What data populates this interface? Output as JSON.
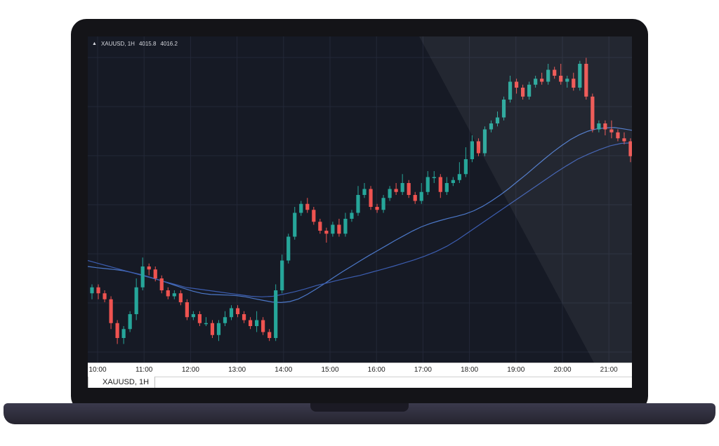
{
  "header": {
    "symbol_label": "XAUUSD, 1H",
    "value1": "4015.8",
    "value2": "4016.2"
  },
  "tab": {
    "label": "XAUUSD, 1H"
  },
  "colors": {
    "up": "#26a69a",
    "down": "#ef5350",
    "ma_fast": "#4c78c9",
    "ma_slow": "#3c5db0",
    "grid": "#232838"
  },
  "chart_data": {
    "type": "candlestick",
    "x_ticks": [
      "10:00",
      "11:00",
      "12:00",
      "13:00",
      "14:00",
      "15:00",
      "16:00",
      "17:00",
      "18:00",
      "19:00",
      "20:00",
      "21:00"
    ],
    "ylim": [
      0,
      100
    ],
    "grid": true,
    "series": [
      {
        "type": "candles",
        "values": [
          [
            19,
            21,
            17,
            22
          ],
          [
            21,
            19,
            17,
            22
          ],
          [
            19,
            17,
            16,
            20
          ],
          [
            17,
            9,
            7,
            18
          ],
          [
            9,
            4,
            2,
            10
          ],
          [
            4,
            7,
            2,
            8
          ],
          [
            7,
            12,
            6,
            13
          ],
          [
            12,
            21,
            10,
            24
          ],
          [
            21,
            28,
            20,
            31
          ],
          [
            28,
            27,
            25,
            29
          ],
          [
            27,
            24,
            23,
            28
          ],
          [
            24,
            20,
            19,
            25
          ],
          [
            20,
            18,
            17,
            21
          ],
          [
            18,
            19,
            17,
            20
          ],
          [
            19,
            16,
            15,
            20
          ],
          [
            16,
            11,
            10,
            17
          ],
          [
            11,
            12,
            10,
            13
          ],
          [
            12,
            9,
            8,
            13
          ],
          [
            9,
            9,
            8,
            11
          ],
          [
            9,
            5,
            4,
            10
          ],
          [
            5,
            9,
            3,
            10
          ],
          [
            9,
            11,
            8,
            13
          ],
          [
            11,
            14,
            10,
            15
          ],
          [
            14,
            12,
            11,
            15
          ],
          [
            12,
            10,
            9,
            13
          ],
          [
            10,
            8,
            7,
            11
          ],
          [
            8,
            10,
            6,
            13
          ],
          [
            10,
            6,
            5,
            11
          ],
          [
            6,
            4,
            3,
            7
          ],
          [
            4,
            20,
            3,
            22
          ],
          [
            20,
            30,
            19,
            32
          ],
          [
            30,
            38,
            29,
            39
          ],
          [
            38,
            46,
            37,
            48
          ],
          [
            46,
            49,
            45,
            50
          ],
          [
            49,
            47,
            46,
            51
          ],
          [
            47,
            43,
            42,
            48
          ],
          [
            43,
            40,
            39,
            44
          ],
          [
            40,
            39,
            36,
            41
          ],
          [
            39,
            42,
            38,
            43
          ],
          [
            42,
            39,
            38,
            44
          ],
          [
            39,
            44,
            38,
            46
          ],
          [
            44,
            46,
            43,
            47
          ],
          [
            46,
            52,
            45,
            55
          ],
          [
            52,
            54,
            51,
            56
          ],
          [
            54,
            48,
            47,
            55
          ],
          [
            48,
            47,
            46,
            49
          ],
          [
            47,
            51,
            46,
            52
          ],
          [
            51,
            54,
            50,
            55
          ],
          [
            54,
            53,
            52,
            56
          ],
          [
            53,
            56,
            52,
            59
          ],
          [
            56,
            52,
            51,
            57
          ],
          [
            52,
            50,
            49,
            53
          ],
          [
            50,
            53,
            49,
            56
          ],
          [
            53,
            58,
            52,
            60
          ],
          [
            58,
            58,
            56,
            60
          ],
          [
            58,
            53,
            51,
            59
          ],
          [
            53,
            56,
            52,
            58
          ],
          [
            56,
            57,
            55,
            58
          ],
          [
            57,
            59,
            56,
            63
          ],
          [
            59,
            64,
            58,
            68
          ],
          [
            64,
            70,
            63,
            72
          ],
          [
            70,
            66,
            65,
            71
          ],
          [
            66,
            74,
            65,
            75
          ],
          [
            74,
            76,
            73,
            77
          ],
          [
            76,
            78,
            75,
            80
          ],
          [
            78,
            84,
            77,
            85
          ],
          [
            84,
            90,
            83,
            92
          ],
          [
            90,
            88,
            86,
            91
          ],
          [
            88,
            85,
            84,
            89
          ],
          [
            85,
            89,
            84,
            90
          ],
          [
            89,
            91,
            88,
            92
          ],
          [
            91,
            90,
            89,
            93
          ],
          [
            90,
            94,
            89,
            96
          ],
          [
            94,
            92,
            91,
            95
          ],
          [
            92,
            90,
            89,
            96
          ],
          [
            90,
            91,
            88,
            92
          ],
          [
            91,
            88,
            87,
            93
          ],
          [
            88,
            96,
            87,
            97
          ],
          [
            96,
            85,
            84,
            98
          ],
          [
            85,
            74,
            73,
            86
          ],
          [
            74,
            76,
            73,
            77
          ],
          [
            76,
            74,
            72,
            77
          ],
          [
            74,
            73,
            71,
            77
          ],
          [
            73,
            71,
            70,
            74
          ],
          [
            71,
            70,
            69,
            73
          ],
          [
            70,
            65,
            63,
            71
          ]
        ]
      },
      {
        "type": "line",
        "role": "ma_fast",
        "values": [
          28,
          27.6,
          27.3,
          27,
          26.6,
          26,
          25.3,
          24.5,
          23.6,
          22.6,
          21.6,
          20.6,
          19.7,
          19,
          18.6,
          18.5,
          18.4,
          18.2,
          17.8,
          17.2,
          16.6,
          16.1,
          15.9,
          16.2,
          17.1,
          18.6,
          20.4,
          22.3,
          24.3,
          26.2,
          28,
          29.8,
          31.6,
          33.3,
          35,
          36.7,
          38.3,
          39.9,
          41.3,
          42.4,
          43.3,
          44.1,
          44.8,
          45.6,
          46.7,
          48.2,
          50,
          52,
          54.2,
          56.6,
          59,
          61.5,
          64,
          66.4,
          68.6,
          70.6,
          72.2,
          73.4,
          74.2,
          74.5,
          74.6,
          74.2,
          73.7
        ]
      },
      {
        "type": "line",
        "role": "ma_slow",
        "values": [
          30,
          29,
          28,
          27,
          26,
          25,
          24,
          23,
          22,
          21,
          20.5,
          20,
          19.5,
          19,
          18.5,
          18,
          17.8,
          18,
          18.7,
          19.5,
          20.5,
          21.6,
          22.5,
          23.4,
          24.2,
          25,
          26,
          27,
          28,
          29.1,
          30.2,
          31.5,
          33,
          34.8,
          37,
          39.5,
          42,
          44.5,
          47,
          49.5,
          52,
          54.5,
          57,
          59.5,
          61.8,
          64,
          65.7,
          67.2,
          68.5,
          69.3,
          69.5
        ]
      }
    ]
  }
}
